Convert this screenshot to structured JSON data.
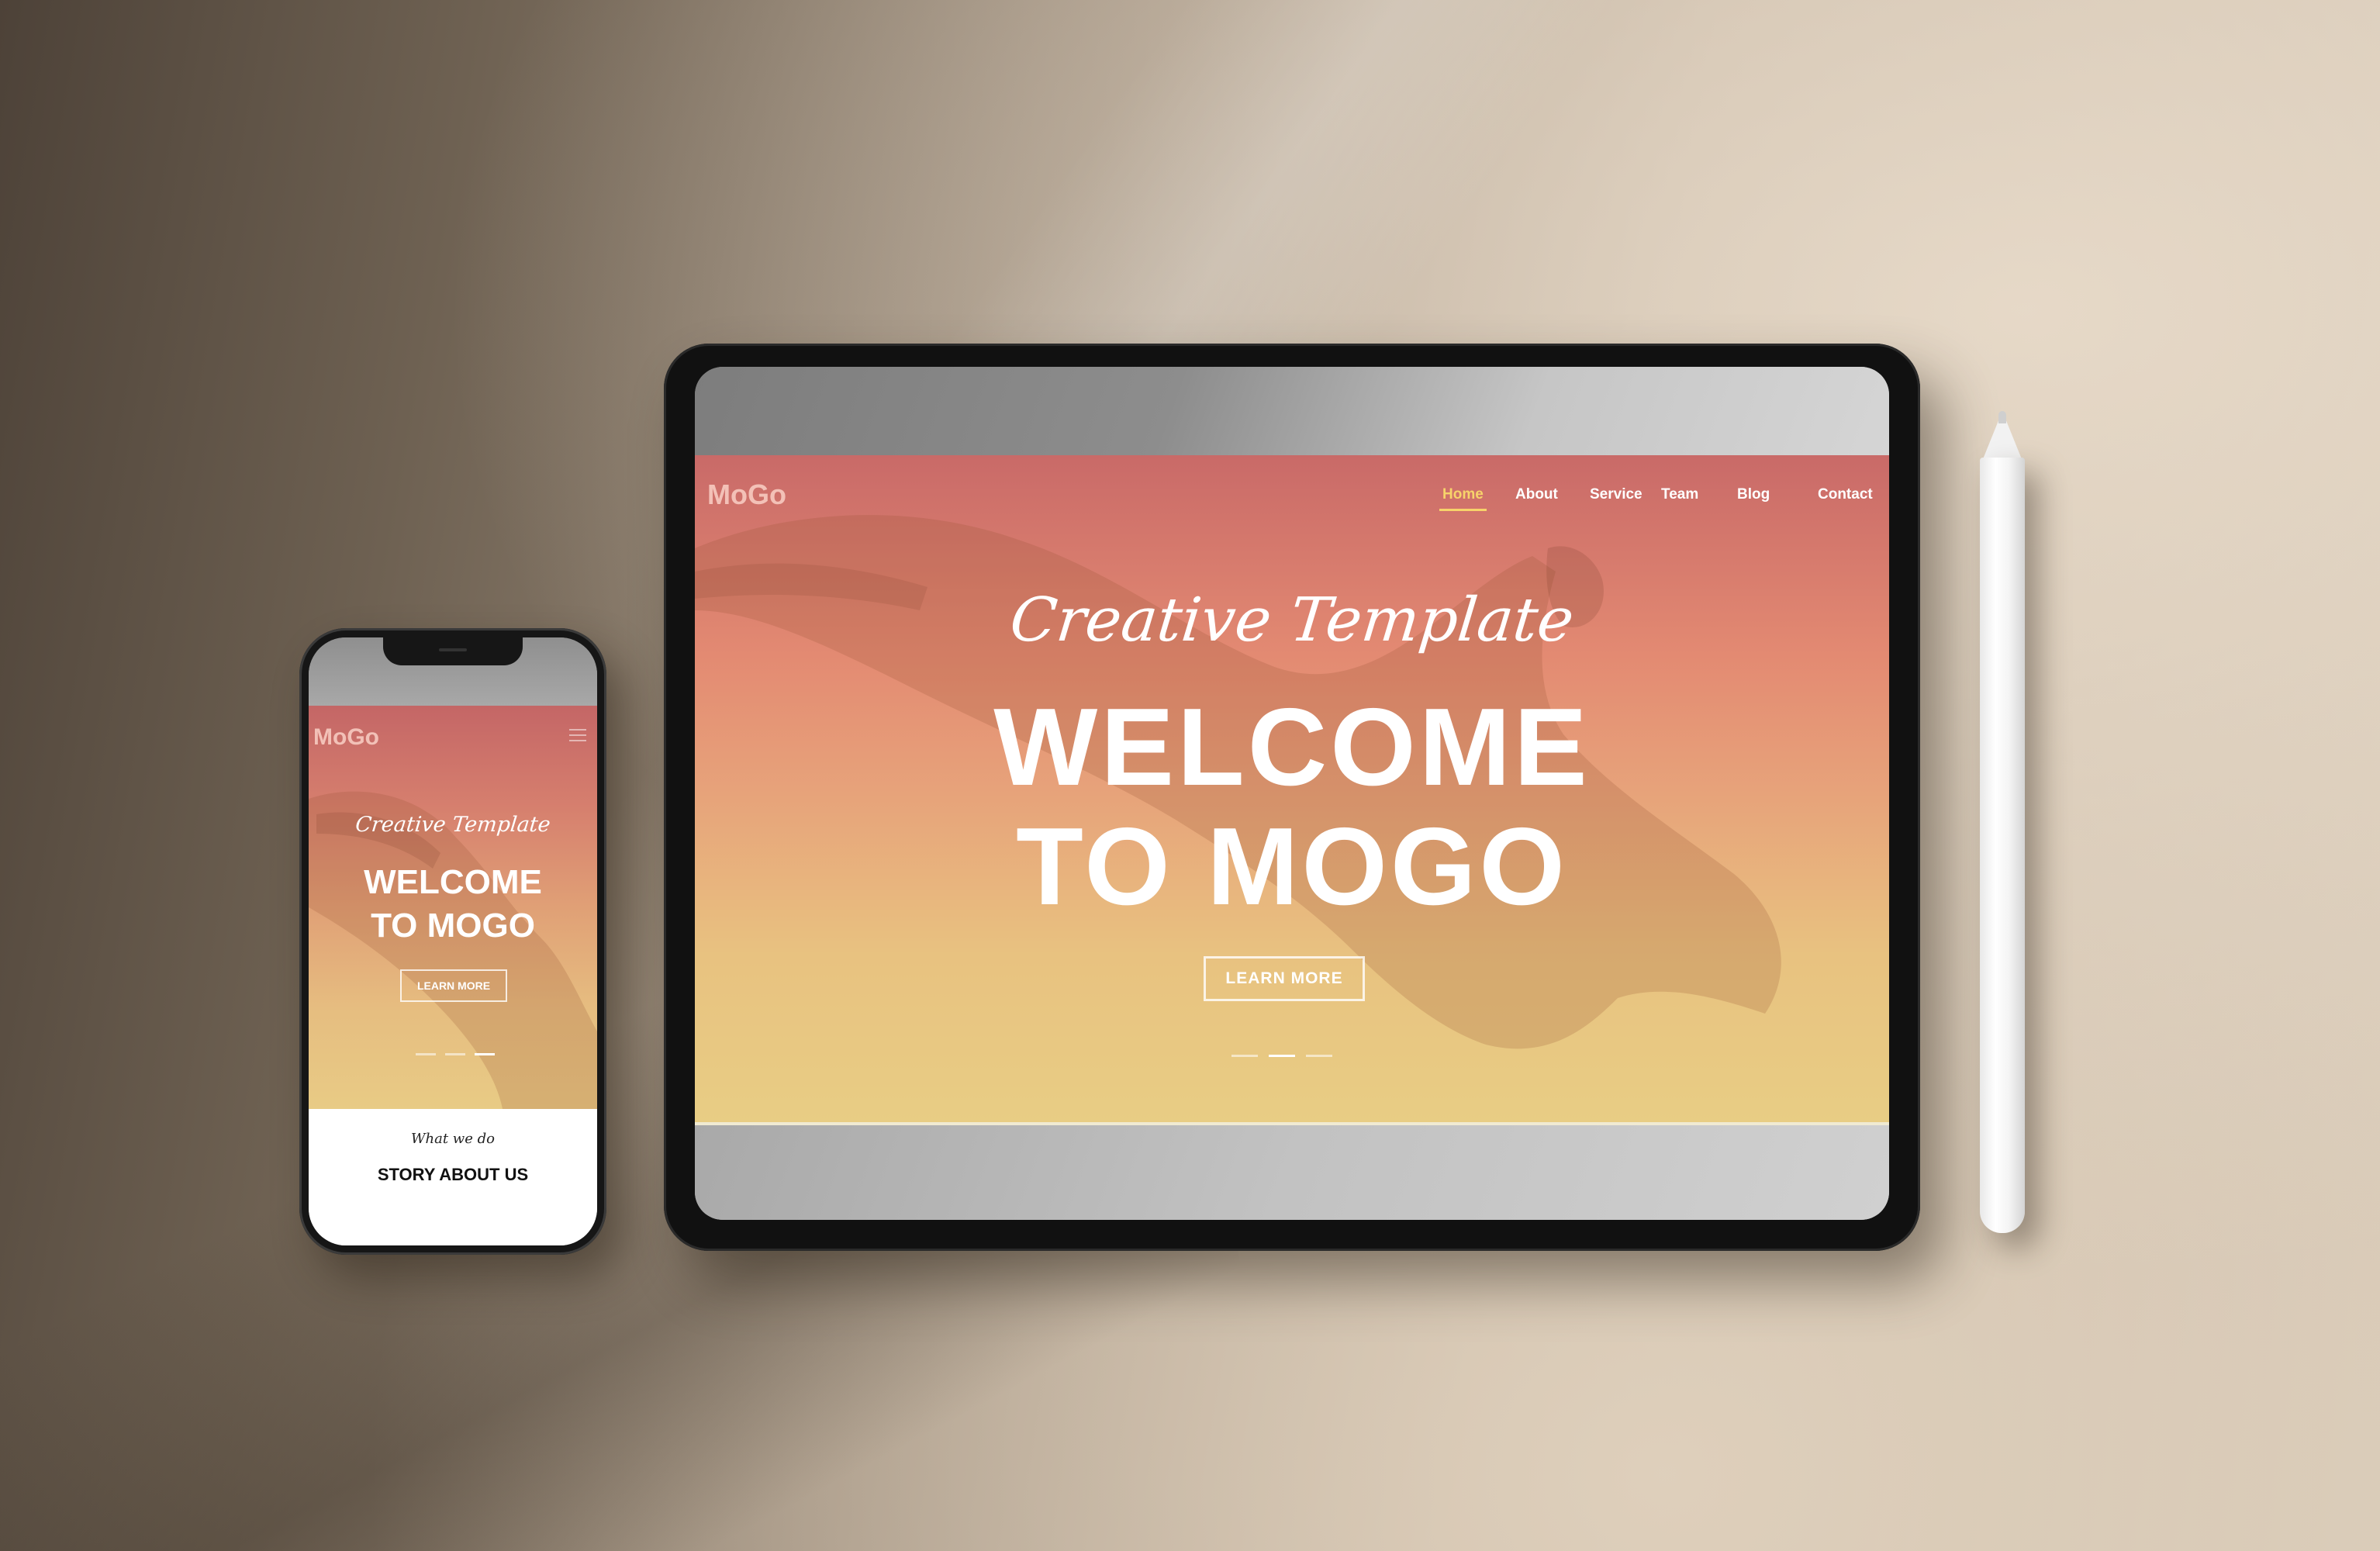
{
  "tablet": {
    "logo": "MoGo",
    "nav": [
      {
        "label": "Home",
        "active": true
      },
      {
        "label": "About",
        "active": false
      },
      {
        "label": "Service",
        "active": false
      },
      {
        "label": "Team",
        "active": false
      },
      {
        "label": "Blog",
        "active": false
      },
      {
        "label": "Contact",
        "active": false
      }
    ],
    "hero": {
      "script_title": "Creative Template",
      "headline_line1": "WELCOME",
      "headline_line2": "TO MOGO",
      "button_label": "LEARN MORE"
    },
    "slider": {
      "count": 3,
      "active_index": 1
    }
  },
  "phone": {
    "logo": "MoGo",
    "menu_icon": "hamburger-icon",
    "hero": {
      "script_title": "Creative Template",
      "headline_line1": "WELCOME",
      "headline_line2": "TO MOGO",
      "button_label": "LEARN MORE"
    },
    "slider": {
      "count": 3,
      "active_index": 2
    },
    "section": {
      "script_title": "What we do",
      "heading": "STORY ABOUT US"
    }
  },
  "colors": {
    "nav_active": "#f7d36a",
    "hero_gradient_top": "#c96a68",
    "hero_gradient_bottom": "#e8cd84"
  }
}
